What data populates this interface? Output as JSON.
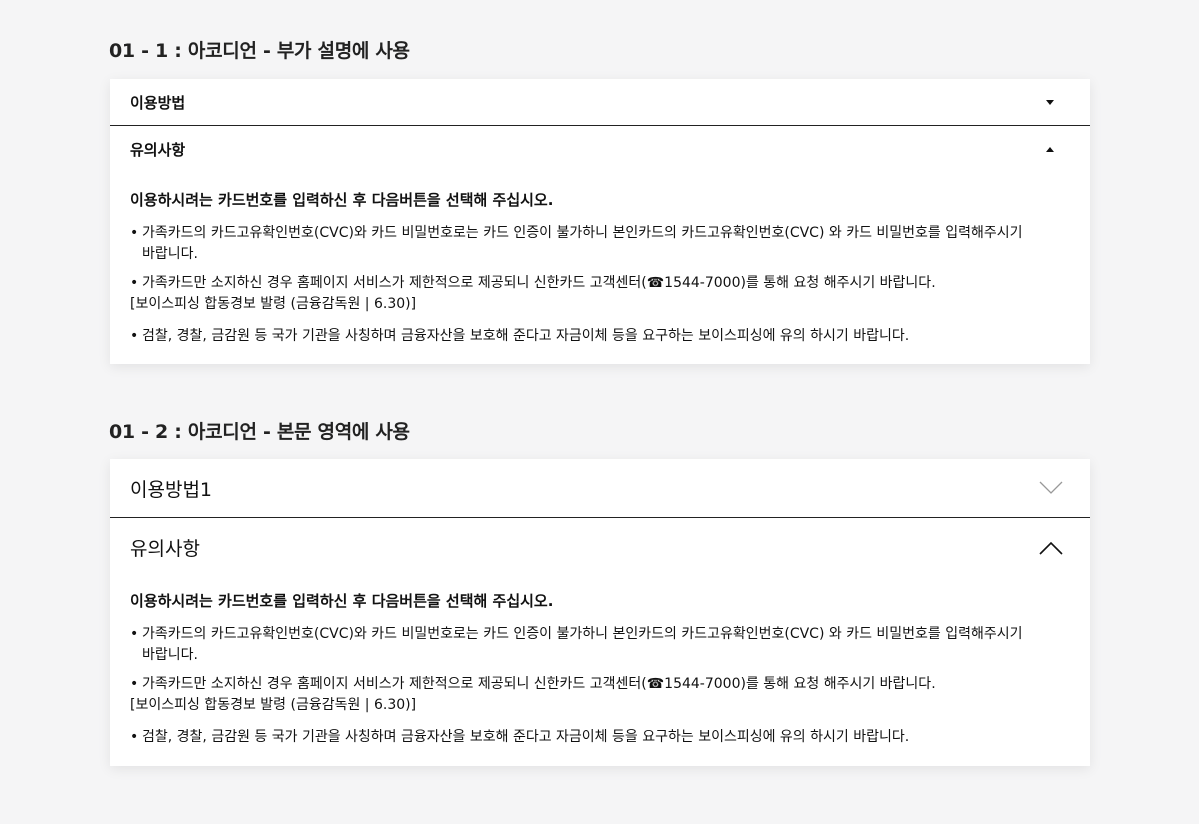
{
  "section1": {
    "title": "01 - 1 : 아코디언 - 부가 설명에 사용",
    "item1_label": "이용방법",
    "item2_label": "유의사항",
    "lead": "이용하시려는 카드번호를 입력하신 후 다음버튼을 선택해 주십시오.",
    "bullet1_line1": "가족카드의 카드고유확인번호(CVC)와 카드 비밀번호로는 카드 인증이 불가하니 본인카드의 카드고유확인번호(CVC) 와 카드 비밀번호를 입력해주시기",
    "bullet1_line2": "바랍니다.",
    "bullet2": "가족카드만 소지하신 경우 홈페이지 서비스가 제한적으로 제공되니 신한카드 고객센터(☎1544-7000)를 통해 요청 해주시기 바랍니다.",
    "note": "[보이스피싱 합동경보 발령 (금융감독원 | 6.30)]",
    "bullet3": "검찰, 경찰, 금감원 등 국가 기관을 사칭하며 금융자산을 보호해 준다고 자금이체 등을 요구하는 보이스피싱에 유의 하시기 바랍니다.",
    "bullet_char": "•"
  },
  "section2": {
    "title": "01 - 2 : 아코디언 - 본문 영역에 사용",
    "item1_label": "이용방법1",
    "item2_label": "유의사항",
    "lead": "이용하시려는 카드번호를 입력하신 후 다음버튼을 선택해 주십시오.",
    "bullet1_line1": "가족카드의 카드고유확인번호(CVC)와 카드 비밀번호로는 카드 인증이 불가하니 본인카드의 카드고유확인번호(CVC) 와 카드 비밀번호를 입력해주시기",
    "bullet1_line2": "바랍니다.",
    "bullet2": "가족카드만 소지하신 경우 홈페이지 서비스가 제한적으로 제공되니 신한카드 고객센터(☎1544-7000)를 통해 요청 해주시기 바랍니다.",
    "note": "[보이스피싱 합동경보 발령 (금융감독원 | 6.30)]",
    "bullet3": "검찰, 경찰, 금감원 등 국가 기관을 사칭하며 금융자산을 보호해 준다고 자금이체 등을 요구하는 보이스피싱에 유의 하시기 바랍니다.",
    "bullet_char": "•"
  },
  "icons": {
    "collapsed_small": "caret-down-icon",
    "expanded_small": "caret-up-icon",
    "collapsed_large": "chevron-down-icon",
    "expanded_large": "chevron-up-icon"
  }
}
